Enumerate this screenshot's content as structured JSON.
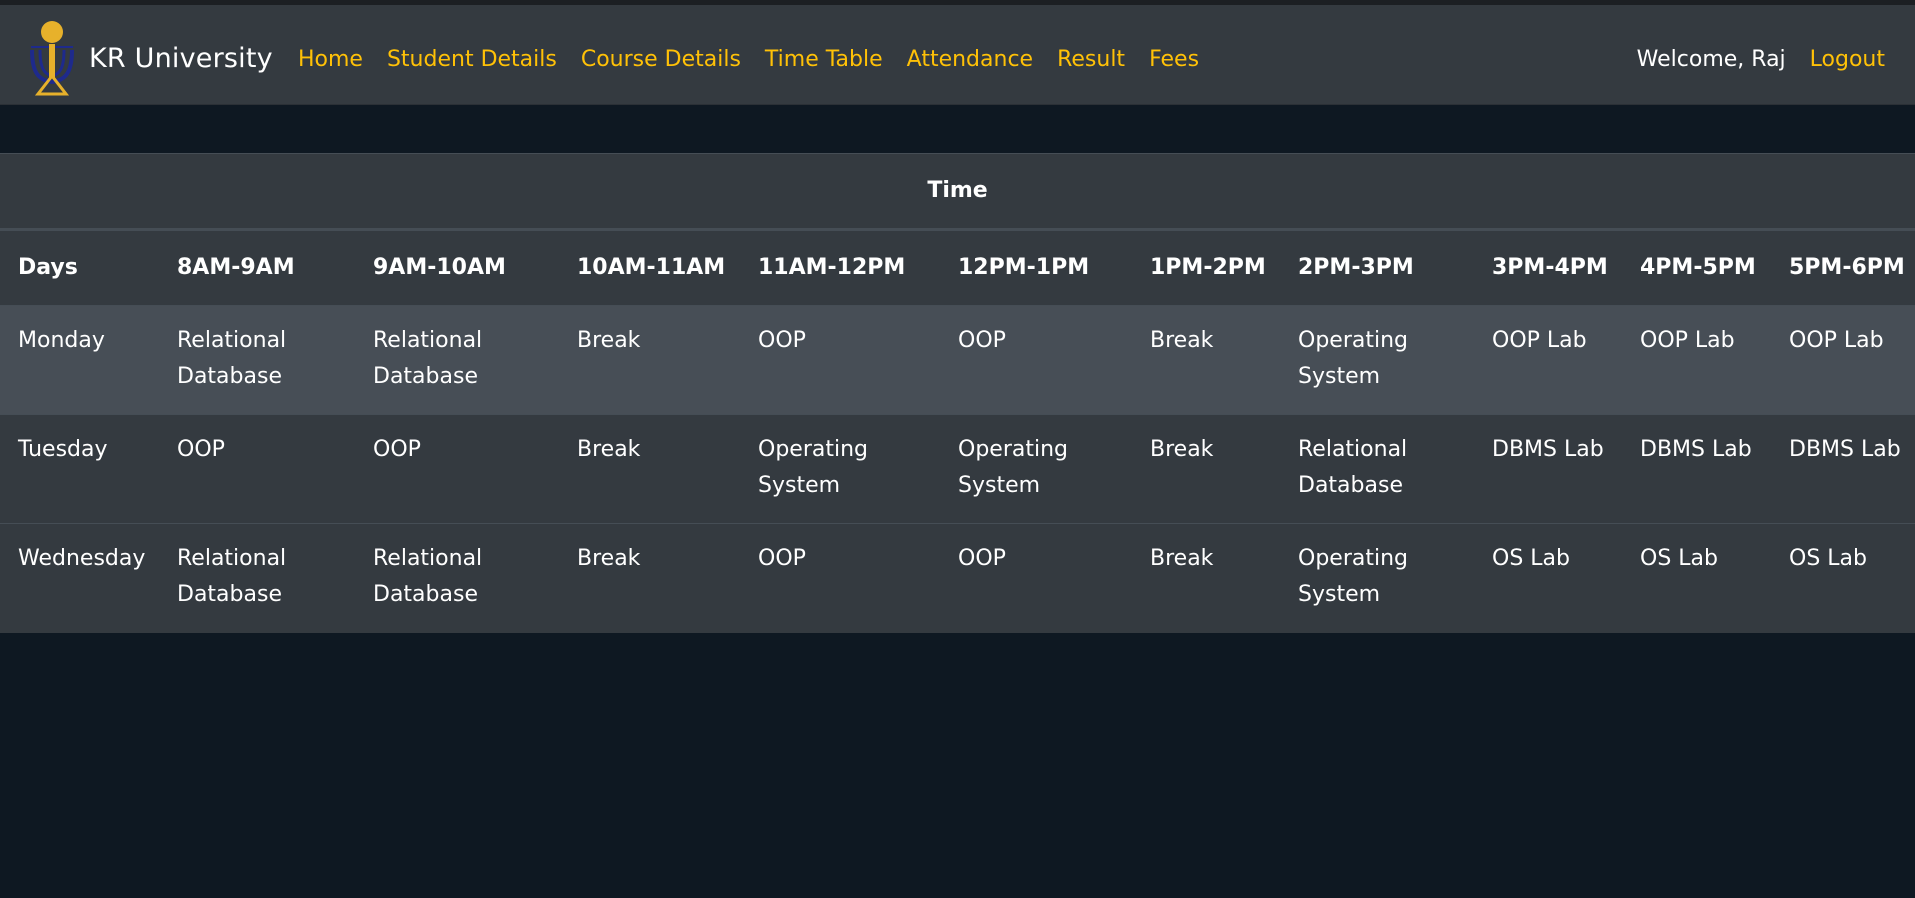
{
  "brand": {
    "name": "KR University",
    "logo_icon": "university-crest-icon",
    "colors": {
      "gold": "#e7b12b",
      "navy": "#1e2a8c"
    }
  },
  "nav": {
    "links": [
      "Home",
      "Student Details",
      "Course Details",
      "Time Table",
      "Attendance",
      "Result",
      "Fees"
    ],
    "welcome": "Welcome, Raj",
    "logout": "Logout",
    "link_color": "#ffc107"
  },
  "timetable": {
    "group_header": "Time",
    "headers": [
      "Days",
      "8AM-9AM",
      "9AM-10AM",
      "10AM-11AM",
      "11AM-12PM",
      "12PM-1PM",
      "1PM-2PM",
      "2PM-3PM",
      "3PM-4PM",
      "4PM-5PM",
      "5PM-6PM"
    ],
    "rows": [
      {
        "day": "Monday",
        "slots": [
          "Relational Database",
          "Relational Database",
          "Break",
          "OOP",
          "OOP",
          "Break",
          "Operating System",
          "OOP Lab",
          "OOP Lab",
          "OOP Lab"
        ]
      },
      {
        "day": "Tuesday",
        "slots": [
          "OOP",
          "OOP",
          "Break",
          "Operating System",
          "Operating System",
          "Break",
          "Relational Database",
          "DBMS Lab",
          "DBMS Lab",
          "DBMS Lab"
        ]
      },
      {
        "day": "Wednesday",
        "slots": [
          "Relational Database",
          "Relational Database",
          "Break",
          "OOP",
          "OOP",
          "Break",
          "Operating System",
          "OS Lab",
          "OS Lab",
          "OS Lab"
        ]
      }
    ]
  }
}
